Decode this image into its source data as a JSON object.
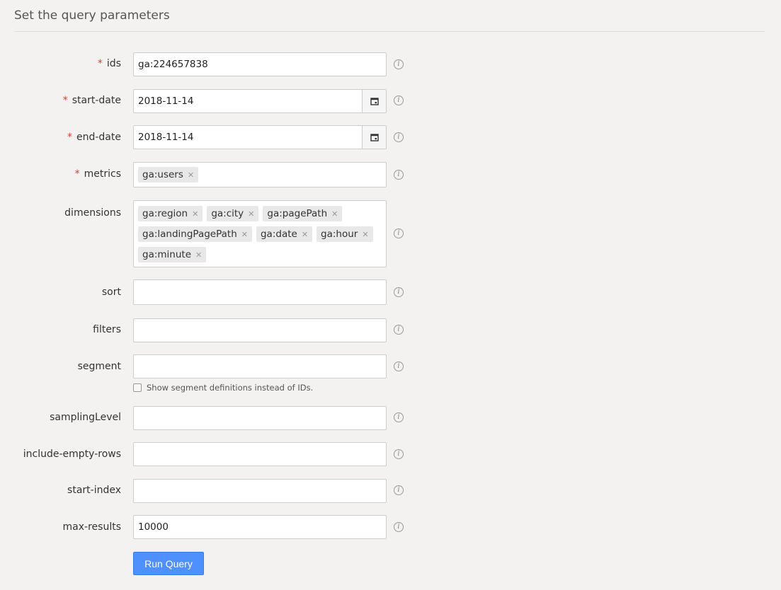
{
  "header": {
    "title": "Set the query parameters"
  },
  "required_marker": "*",
  "info_glyph": "i",
  "fields": {
    "ids": {
      "label": "ids",
      "value": "ga:224657838"
    },
    "start_date": {
      "label": "start-date",
      "value": "2018-11-14"
    },
    "end_date": {
      "label": "end-date",
      "value": "2018-11-14"
    },
    "metrics": {
      "label": "metrics",
      "chips": [
        "ga:users"
      ]
    },
    "dimensions": {
      "label": "dimensions",
      "chips": [
        "ga:region",
        "ga:city",
        "ga:pagePath",
        "ga:landingPagePath",
        "ga:date",
        "ga:hour",
        "ga:minute"
      ]
    },
    "sort": {
      "label": "sort",
      "value": ""
    },
    "filters": {
      "label": "filters",
      "value": ""
    },
    "segment": {
      "label": "segment",
      "value": "",
      "checkbox_label": "Show segment definitions instead of IDs."
    },
    "sampling_level": {
      "label": "samplingLevel",
      "value": ""
    },
    "include_empty_rows": {
      "label": "include-empty-rows",
      "value": ""
    },
    "start_index": {
      "label": "start-index",
      "value": ""
    },
    "max_results": {
      "label": "max-results",
      "value": "10000"
    }
  },
  "chip_remove_glyph": "✕",
  "run_button": {
    "label": "Run Query"
  },
  "icons": {
    "calendar": "calendar-icon",
    "info": "info-icon",
    "remove": "close-icon"
  },
  "colors": {
    "accent": "#4d90fe",
    "required": "#d23f31",
    "background": "#f3f2f0"
  }
}
